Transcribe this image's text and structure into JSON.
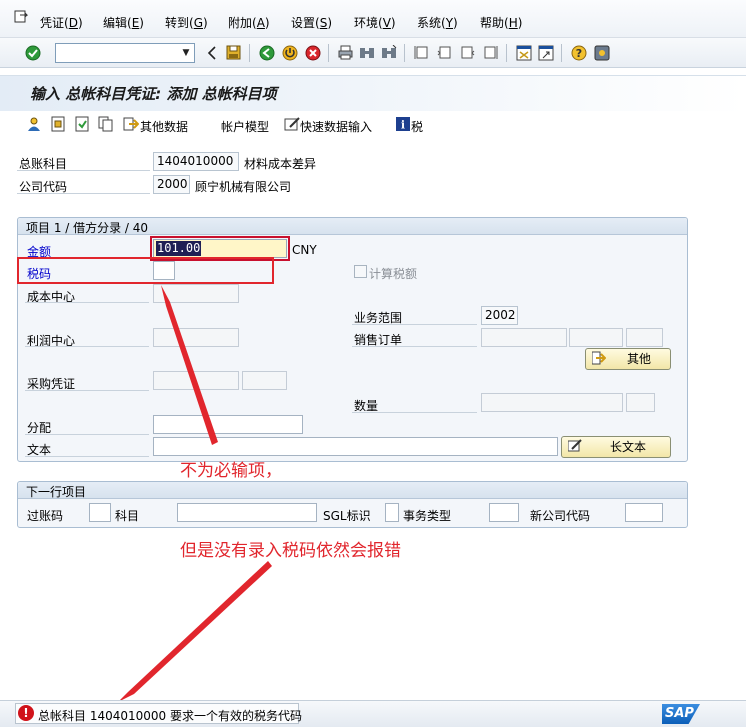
{
  "menu": {
    "items": [
      {
        "label": "凭证",
        "key": "D"
      },
      {
        "label": "编辑",
        "key": "E"
      },
      {
        "label": "转到",
        "key": "G"
      },
      {
        "label": "附加",
        "key": "A"
      },
      {
        "label": "设置",
        "key": "S"
      },
      {
        "label": "环境",
        "key": "V"
      },
      {
        "label": "系统",
        "key": "Y"
      },
      {
        "label": "帮助",
        "key": "H"
      }
    ]
  },
  "toolbar": {
    "command_field_value": "",
    "icons": [
      "enter-icon",
      "back-icon",
      "save-icon",
      "back-green-icon",
      "exit-icon",
      "cancel-icon",
      "print-icon",
      "find-icon",
      "find-next-icon",
      "first-page-icon",
      "previous-page-icon",
      "next-page-icon",
      "last-page-icon",
      "new-session-icon",
      "shortcut-icon",
      "help-icon",
      "layout-icon"
    ]
  },
  "title": "输入 总帐科目凭证: 添加 总帐科目项",
  "app_toolbar": {
    "other_data": "其他数据",
    "account_model": "帐户模型",
    "fast_entry": "快速数据输入",
    "tax": "税"
  },
  "header": {
    "gl_account_label": "总账科目",
    "gl_account_value": "1404010000",
    "gl_account_desc": "材料成本差异",
    "company_code_label": "公司代码",
    "company_code_value": "2000",
    "company_code_desc": "顾宁机械有限公司"
  },
  "item_group": {
    "title": "项目 1 / 借方分录 / 40",
    "amount_label": "金额",
    "amount_value": "101.00",
    "currency": "CNY",
    "tax_code_label": "税码",
    "tax_code_value": "",
    "calc_tax_label": "计算税额",
    "cost_center_label": "成本中心",
    "business_area_label": "业务范围",
    "business_area_value": "2002",
    "profit_center_label": "利润中心",
    "sales_order_label": "销售订单",
    "other_button": "其他",
    "purchase_doc_label": "采购凭证",
    "quantity_label": "数量",
    "assignment_label": "分配",
    "text_label": "文本",
    "long_text_button": "长文本"
  },
  "next_item_group": {
    "title": "下一行项目",
    "posting_key_label": "过账码",
    "account_label": "科目",
    "sgl_label": "SGL标识",
    "trans_type_label": "事务类型",
    "new_company_label": "新公司代码"
  },
  "annotations": {
    "note1": "不为必输项，",
    "note2": "但是没有录入税码依然会报错"
  },
  "status": {
    "message": "总帐科目 1404010000 要求一个有效的税务代码"
  },
  "colors": {
    "annotation_red": "#e1262d",
    "error_red": "#d0121a",
    "amount_highlight_bg": "#1f1f55",
    "required_field_bg": "#fff6c8"
  }
}
